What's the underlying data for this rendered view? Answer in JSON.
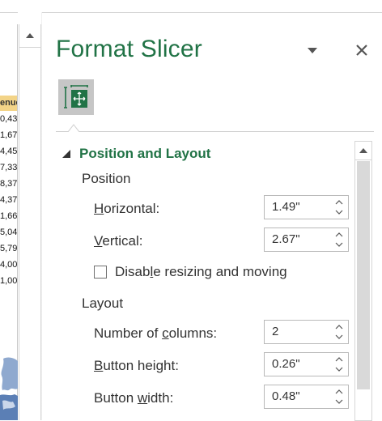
{
  "sheet": {
    "column_header": "enue",
    "cells": [
      "0,43",
      "1,67",
      "4,45",
      "7,33",
      "8,37",
      "4,37",
      "1,66",
      "5,04",
      "5,79",
      "4,00",
      "1,00"
    ]
  },
  "pane": {
    "title": "Format Slicer",
    "tab_icon": "size-properties-icon",
    "section": {
      "label": "Position and Layout",
      "position_heading": "Position",
      "horizontal": {
        "label_pre": "",
        "label_key": "H",
        "label_post": "orizontal:",
        "value": "1.49\""
      },
      "vertical": {
        "label_pre": "",
        "label_key": "V",
        "label_post": "ertical:",
        "value": "2.67\""
      },
      "disable_resize": {
        "label_pre": "Disab",
        "label_key": "l",
        "label_post": "e resizing and moving",
        "checked": false
      },
      "layout_heading": "Layout",
      "columns": {
        "label_pre": "Number of ",
        "label_key": "c",
        "label_post": "olumns:",
        "value": "2"
      },
      "button_height": {
        "label_pre": "",
        "label_key": "B",
        "label_post": "utton height:",
        "value": "0.26\""
      },
      "button_width": {
        "label_pre": "Button ",
        "label_key": "w",
        "label_post": "idth:",
        "value": "0.48\""
      }
    }
  },
  "colors": {
    "accent": "#217346",
    "header_fill": "#f3d488",
    "icon_bg": "#c6c6c6"
  }
}
